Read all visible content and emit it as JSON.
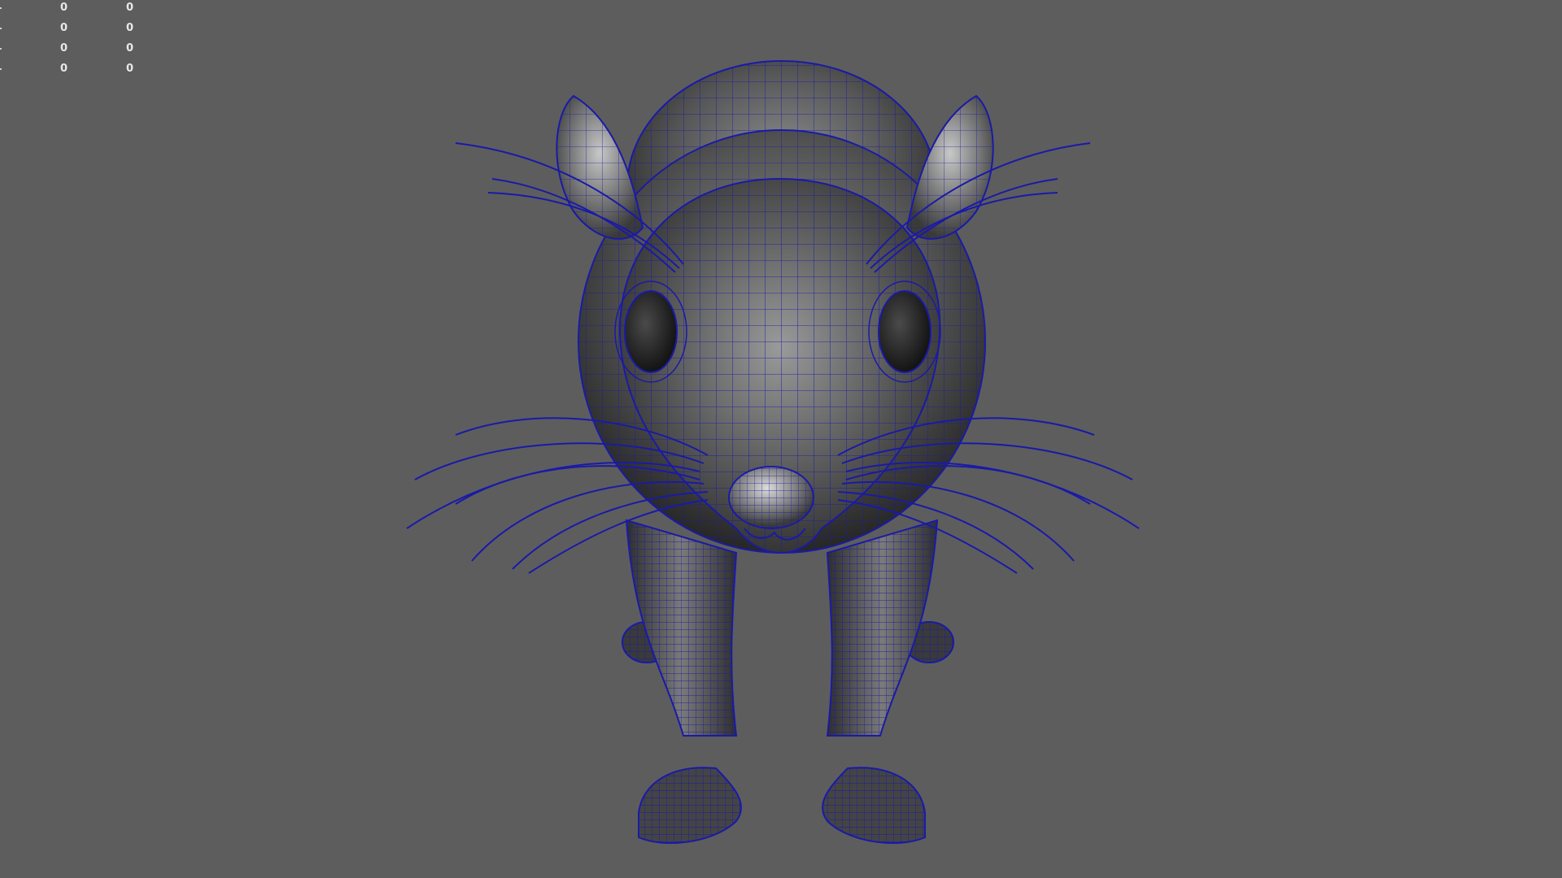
{
  "viewport": {
    "background": "#5d5d5d",
    "wire_color": "#1a1aa8",
    "hud_rows": [
      {
        "a": "0",
        "b": "0"
      },
      {
        "a": "0",
        "b": "0"
      },
      {
        "a": "0",
        "b": "0"
      },
      {
        "a": "0",
        "b": "0"
      }
    ]
  },
  "model": {
    "icon": "mouse-wireframe-model"
  }
}
